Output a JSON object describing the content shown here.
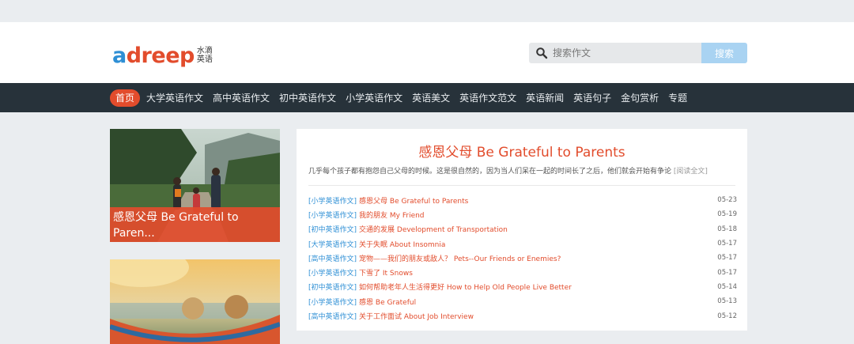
{
  "logo": {
    "text_a": "a",
    "text_rest": "dreep",
    "cn_line1": "水滴",
    "cn_line2": "英语"
  },
  "search": {
    "placeholder": "搜索作文",
    "button_label": "搜索"
  },
  "nav": {
    "items": [
      {
        "label": "首页",
        "active": true
      },
      {
        "label": "大学英语作文"
      },
      {
        "label": "高中英语作文"
      },
      {
        "label": "初中英语作文"
      },
      {
        "label": "小学英语作文"
      },
      {
        "label": "英语美文"
      },
      {
        "label": "英语作文范文"
      },
      {
        "label": "英语新闻"
      },
      {
        "label": "英语句子"
      },
      {
        "label": "金句赏析"
      },
      {
        "label": "专题"
      }
    ]
  },
  "cards": [
    {
      "caption": "感恩父母 Be Grateful to Paren..."
    },
    {
      "caption": ""
    }
  ],
  "featured": {
    "title": "感恩父母 Be Grateful to Parents",
    "summary": "几乎每个孩子都有抱怨自己父母的时候。这是很自然的，因为当人们呆在一起的时间长了之后，他们就会开始有争论",
    "more_label": "[阅读全文]"
  },
  "articles": [
    {
      "category": "[小学英语作文]",
      "title": "感恩父母 Be Grateful to Parents",
      "date": "05-23"
    },
    {
      "category": "[小学英语作文]",
      "title": "我的朋友 My Friend",
      "date": "05-19"
    },
    {
      "category": "[初中英语作文]",
      "title": "交通的发展 Development of Transportation",
      "date": "05-18"
    },
    {
      "category": "[大学英语作文]",
      "title": "关于失眠 About Insomnia",
      "date": "05-17"
    },
    {
      "category": "[高中英语作文]",
      "title": "宠物——我们的朋友或敌人？ Pets--Our Friends or Enemies?",
      "date": "05-17"
    },
    {
      "category": "[小学英语作文]",
      "title": "下雪了 It Snows",
      "date": "05-17"
    },
    {
      "category": "[初中英语作文]",
      "title": "如何帮助老年人生活得更好 How to Help Old People Live Better",
      "date": "05-14"
    },
    {
      "category": "[小学英语作文]",
      "title": "感恩 Be Grateful",
      "date": "05-13"
    },
    {
      "category": "[高中英语作文]",
      "title": "关于工作面试 About Job Interview",
      "date": "05-12"
    }
  ],
  "colors": {
    "accent": "#e24c2c",
    "link_blue": "#2e8fd5",
    "nav_bg": "#27323a",
    "search_button": "#a9d3f2"
  }
}
